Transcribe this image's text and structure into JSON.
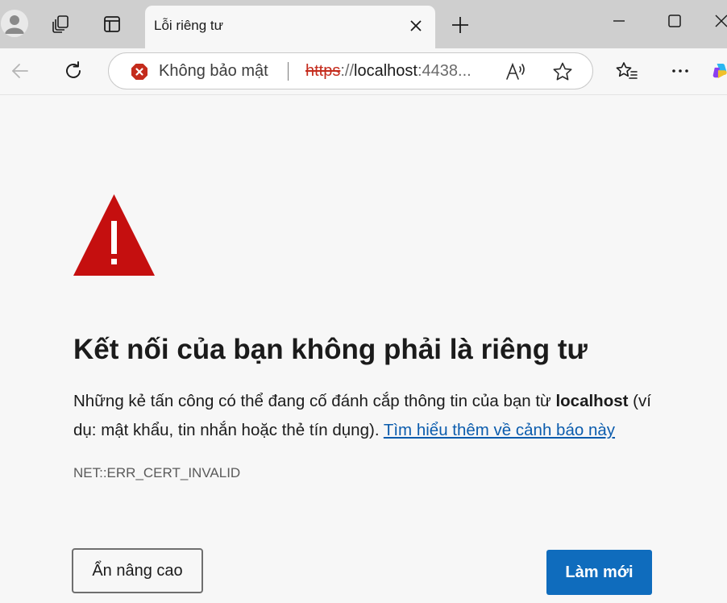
{
  "tab": {
    "title": "Lỗi riêng tư"
  },
  "address_bar": {
    "security_label": "Không bảo mật",
    "url_scheme": "https",
    "url_separator": "://",
    "url_host": "localhost",
    "url_rest": ":4438..."
  },
  "page": {
    "heading": "Kết nối của bạn không phải là riêng tư",
    "description_before_host": "Những kẻ tấn công có thể đang cố đánh cắp thông tin của bạn từ ",
    "description_host": "localhost",
    "description_after_host": " (ví dụ: mật khẩu, tin nhắn hoặc thẻ tín dụng). ",
    "learn_more_link": "Tìm hiểu thêm về cảnh báo này",
    "error_code": "NET::ERR_CERT_INVALID",
    "advanced_button": "Ẩn nâng cao",
    "reload_button": "Làm mới"
  },
  "colors": {
    "warning_red": "#c50f0f",
    "primary_blue": "#0f6cbd",
    "link_blue": "#0b5cad",
    "insecure_red": "#c42b1c"
  },
  "icons": {
    "profile": "avatar-icon",
    "workspaces": "workspaces-icon",
    "tab_actions": "tab-actions-icon",
    "tab_close": "close-icon",
    "new_tab": "plus-icon",
    "minimize": "minimize-icon",
    "maximize": "maximize-icon",
    "close_window": "close-icon",
    "back": "back-arrow-icon",
    "refresh": "refresh-icon",
    "not_secure": "not-secure-icon",
    "read_aloud": "read-aloud-icon",
    "favorite": "star-icon",
    "favorites_list": "favorites-icon",
    "menu": "more-icon",
    "copilot": "copilot-icon",
    "warning": "warning-triangle-icon"
  }
}
